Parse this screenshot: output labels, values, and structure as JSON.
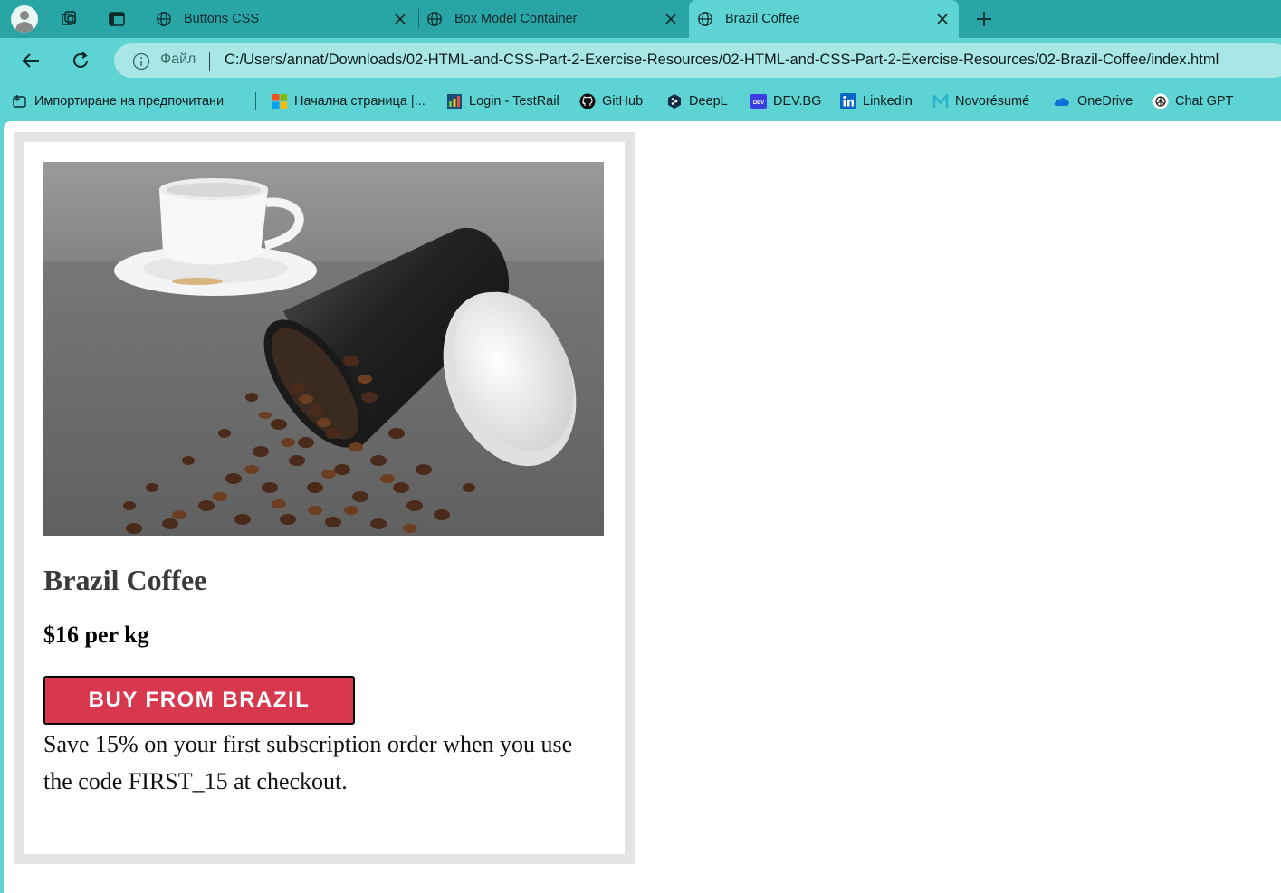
{
  "browser": {
    "tabs": [
      {
        "title": "Buttons CSS",
        "active": false
      },
      {
        "title": "Box Model Container",
        "active": false
      },
      {
        "title": "Brazil Coffee",
        "active": true
      }
    ],
    "address": {
      "file_label": "Файл",
      "url": "C:/Users/annat/Downloads/02-HTML-and-CSS-Part-2-Exercise-Resources/02-HTML-and-CSS-Part-2-Exercise-Resources/02-Brazil-Coffee/index.html"
    },
    "bookmarks": [
      {
        "label": "Импортиране на предпочитани",
        "icon": "import-favorites-icon"
      },
      {
        "label": "Начална страница |...",
        "icon": "windows-logo-icon"
      },
      {
        "label": "Login - TestRail",
        "icon": "testrail-icon"
      },
      {
        "label": "GitHub",
        "icon": "github-icon"
      },
      {
        "label": "DeepL",
        "icon": "deepl-icon"
      },
      {
        "label": "DEV.BG",
        "icon": "devbg-icon"
      },
      {
        "label": "LinkedIn",
        "icon": "linkedin-icon"
      },
      {
        "label": "Novorésumé",
        "icon": "novoresume-icon"
      },
      {
        "label": "OneDrive",
        "icon": "onedrive-icon"
      },
      {
        "label": "Chat GPT",
        "icon": "chatgpt-icon"
      }
    ],
    "colors": {
      "tabstrip": "#2aa5a5",
      "toolbar": "#5ed3d3",
      "omnibox": "#a9e6e6"
    }
  },
  "page": {
    "product_title": "Brazil Coffee",
    "price": "$16 per kg",
    "buy_button": "BUY FROM BRAZIL",
    "promo": "Save 15% on your first subscription order when you use the code FIRST_15 at checkout.",
    "colors": {
      "button": "#d7384d",
      "card_border": "#e4e4e4"
    }
  }
}
